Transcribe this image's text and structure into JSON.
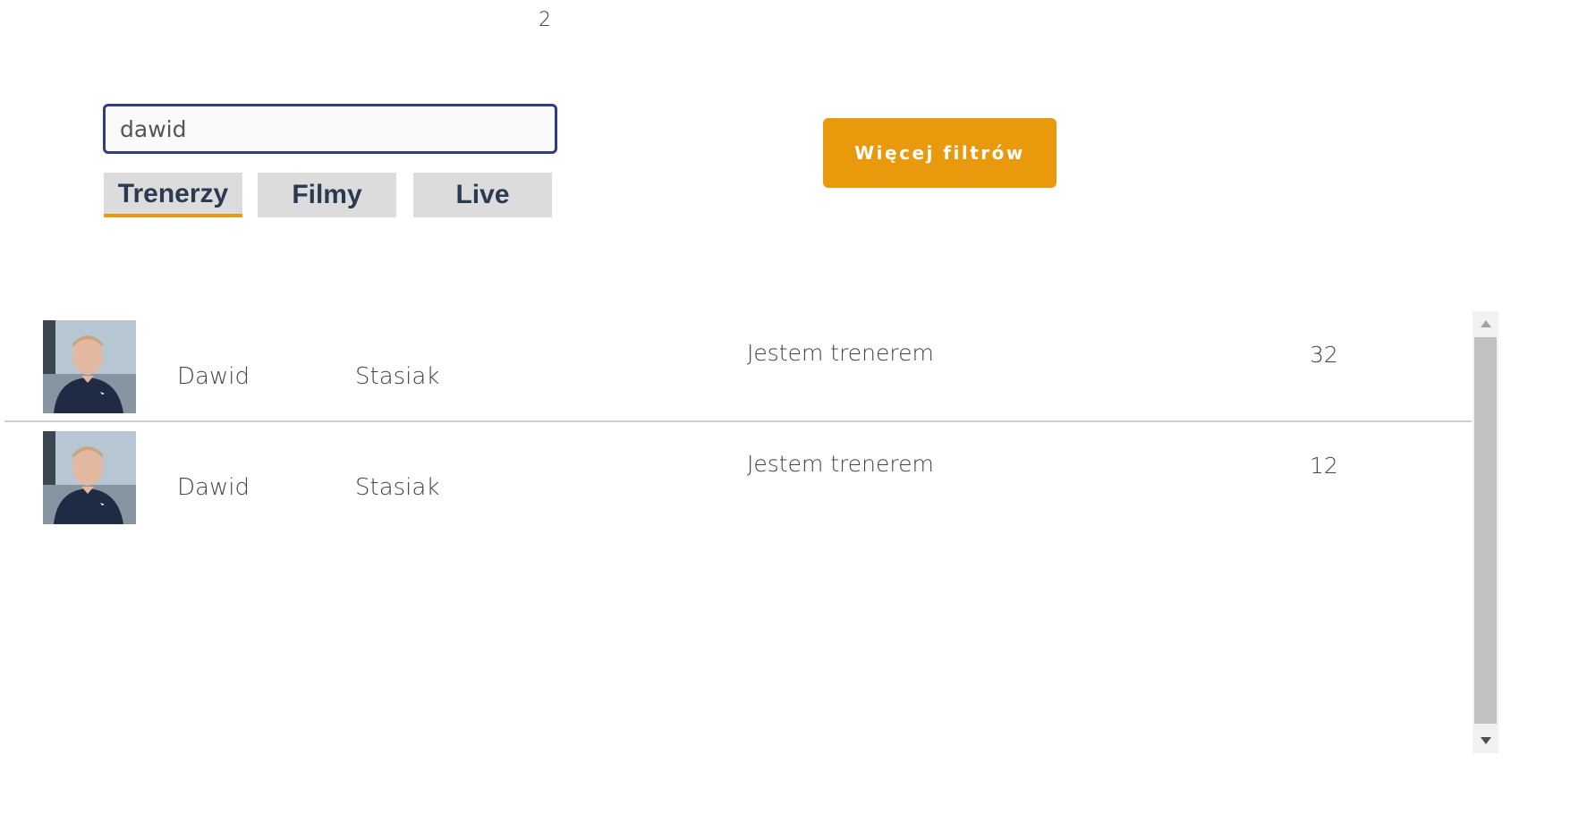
{
  "result_count": "2",
  "search": {
    "value": "dawid",
    "placeholder": ""
  },
  "tabs": [
    {
      "label": "Trenerzy",
      "active": true
    },
    {
      "label": "Filmy",
      "active": false
    },
    {
      "label": "Live",
      "active": false
    }
  ],
  "more_filters_label": "Więcej filtrów",
  "colors": {
    "accent": "#e8990c",
    "input_border": "#2e3d86",
    "tab_text": "#2a3a50",
    "tab_bg": "#dcdcdc"
  },
  "results": [
    {
      "first_name": "Dawid",
      "last_name": "Stasiak",
      "description": "Jestem trenerem",
      "number": "32",
      "avatar_icon": "person-photo"
    },
    {
      "first_name": "Dawid",
      "last_name": "Stasiak",
      "description": "Jestem trenerem",
      "number": "12",
      "avatar_icon": "person-photo"
    }
  ],
  "scrollbar": {
    "up_icon": "arrow-up-icon",
    "down_icon": "arrow-down-icon"
  }
}
